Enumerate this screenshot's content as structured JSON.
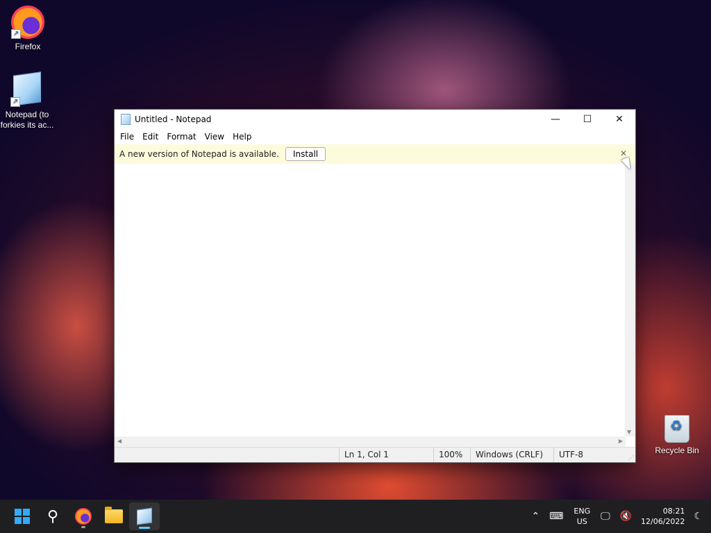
{
  "desktop": {
    "icons": [
      {
        "label": "Firefox"
      },
      {
        "label": "Notepad (to forkies its ac..."
      },
      {
        "label": "Recycle Bin"
      }
    ]
  },
  "window": {
    "title": "Untitled - Notepad",
    "controls": {
      "minimize": "—",
      "maximize": "☐",
      "close": "✕"
    },
    "menu": [
      "File",
      "Edit",
      "Format",
      "View",
      "Help"
    ],
    "infobar": {
      "message": "A new version of Notepad is available.",
      "install_label": "Install",
      "close_glyph": "✕"
    },
    "editor": {
      "value": ""
    },
    "status": {
      "position": "Ln 1, Col 1",
      "zoom": "100%",
      "line_ending": "Windows (CRLF)",
      "encoding": "UTF-8"
    }
  },
  "taskbar": {
    "apps": [
      "start-icon",
      "search-icon",
      "firefox-icon",
      "file-explorer-icon",
      "notepad-icon"
    ],
    "tray": {
      "language_top": "ENG",
      "language_bottom": "US",
      "time": "08:21",
      "date": "12/06/2022"
    }
  },
  "colors": {
    "accent": "#60cdff",
    "infobar_bg": "#fcfbdc",
    "taskbar_bg": "#1f1f22"
  }
}
